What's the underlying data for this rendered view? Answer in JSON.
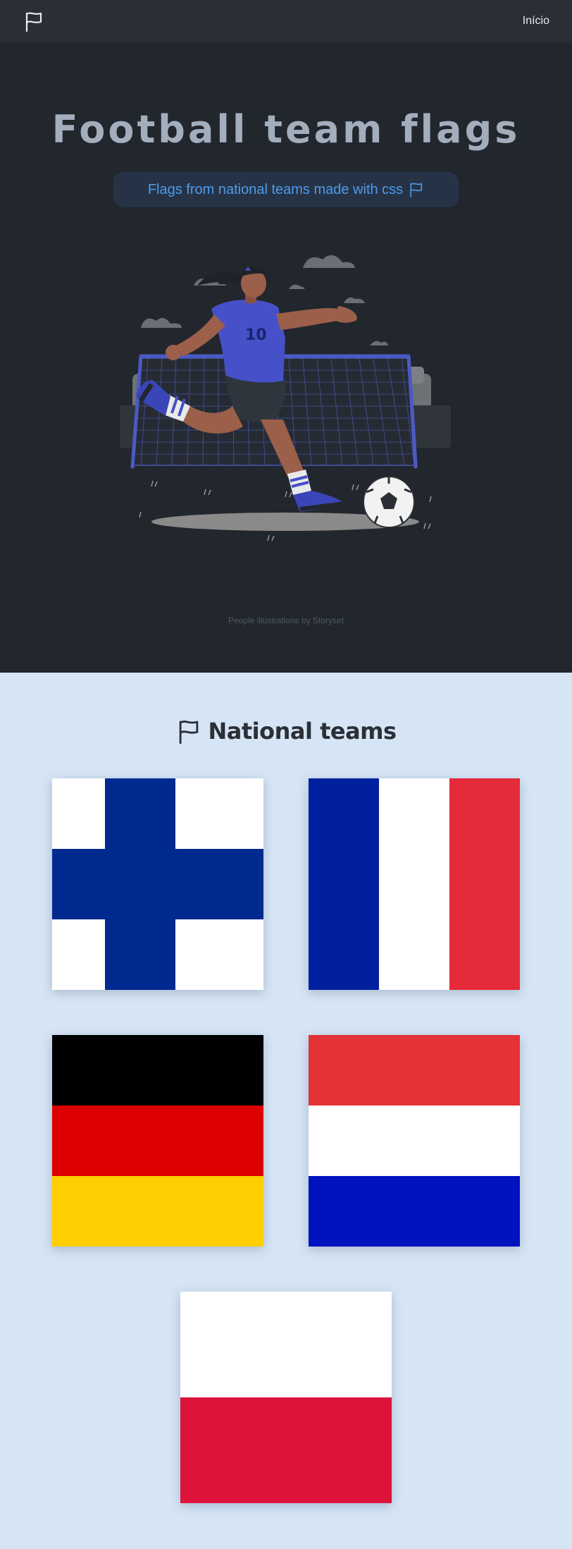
{
  "nav": {
    "link_label": "Início"
  },
  "hero": {
    "title": "Football team flags",
    "subtitle": "Flags from national teams made with css",
    "credit": "People illustrations by Storyset"
  },
  "teams": {
    "heading": "National teams",
    "flags": [
      {
        "icon": "finland-flag",
        "colors": [
          "#ffffff",
          "#002a8f"
        ]
      },
      {
        "icon": "france-flag",
        "colors": [
          "#00209f",
          "#ffffff",
          "#e52a3a"
        ]
      },
      {
        "icon": "germany-flag",
        "colors": [
          "#000000",
          "#dd0000",
          "#ffce00"
        ]
      },
      {
        "icon": "netherlands-flag",
        "colors": [
          "#e43237",
          "#ffffff",
          "#0112bf"
        ]
      },
      {
        "icon": "poland-flag",
        "colors": [
          "#ffffff",
          "#dc143c"
        ]
      }
    ]
  },
  "colors": {
    "navbar": "#2a2f37",
    "hero_bg": "#22262d",
    "page_bg": "#d5e5f5",
    "accent": "#4f9ae8"
  }
}
